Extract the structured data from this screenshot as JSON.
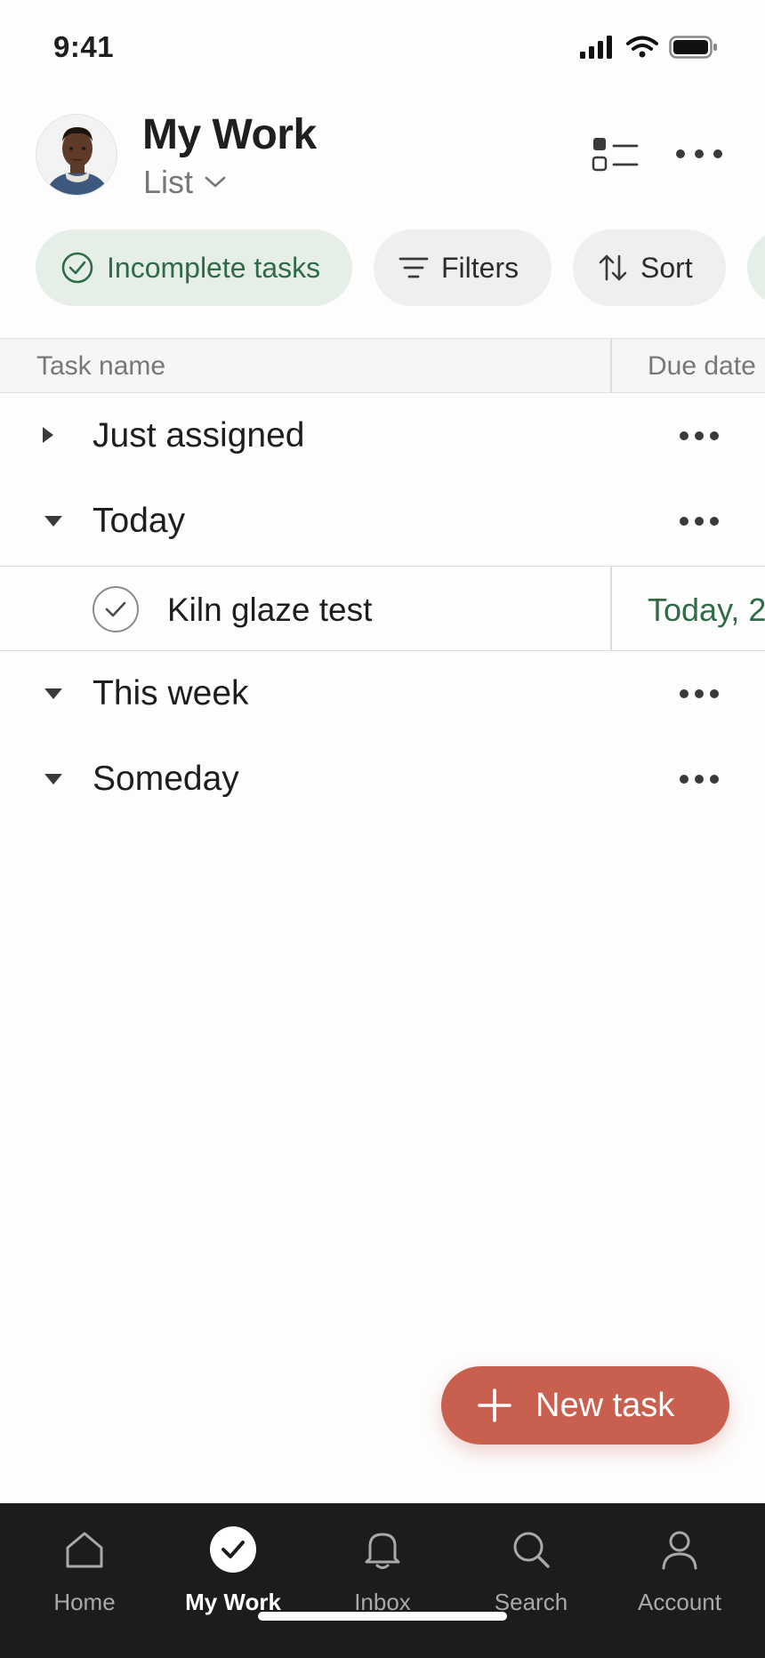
{
  "status_bar": {
    "time": "9:41"
  },
  "header": {
    "title": "My Work",
    "view": "List"
  },
  "chips": {
    "incomplete": "Incomplete tasks",
    "filters": "Filters",
    "sort": "Sort"
  },
  "table": {
    "col_name": "Task name",
    "col_due": "Due date"
  },
  "sections": {
    "just_assigned": "Just assigned",
    "today": "Today",
    "this_week": "This week",
    "someday": "Someday"
  },
  "task": {
    "name": "Kiln glaze test",
    "due": "Today, 2"
  },
  "fab": {
    "label": "New task"
  },
  "nav": {
    "home": "Home",
    "my_work": "My Work",
    "inbox": "Inbox",
    "search": "Search",
    "account": "Account"
  },
  "colors": {
    "accent_green": "#2f6b46",
    "fab": "#c9604f",
    "nav_bg": "#1c1c1c"
  }
}
